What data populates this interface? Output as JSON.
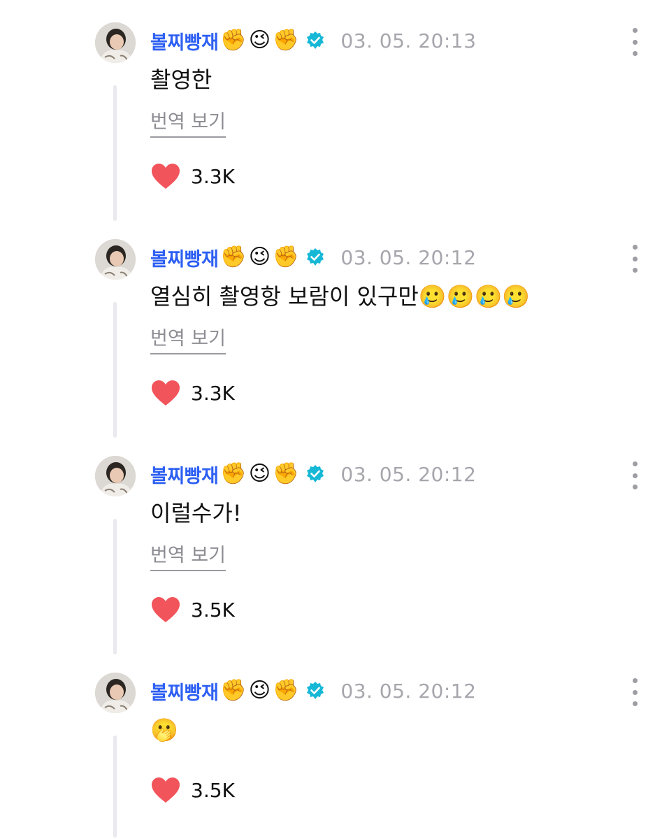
{
  "comments": [
    {
      "username": "볼찌빵재",
      "name_emojis": [
        "✊",
        "😉",
        "✊"
      ],
      "timestamp": "03. 05. 20:13",
      "text": "촬영한",
      "translate_label": "번역 보기",
      "likes": "3.3K"
    },
    {
      "username": "볼찌빵재",
      "name_emojis": [
        "✊",
        "😉",
        "✊"
      ],
      "timestamp": "03. 05. 20:12",
      "text": "열심히 촬영항 보람이 있구만🥲🥲🥲🥲",
      "translate_label": "번역 보기",
      "likes": "3.3K"
    },
    {
      "username": "볼찌빵재",
      "name_emojis": [
        "✊",
        "😉",
        "✊"
      ],
      "timestamp": "03. 05. 20:12",
      "text": "이럴수가!",
      "translate_label": "번역 보기",
      "likes": "3.5K"
    },
    {
      "username": "볼찌빵재",
      "name_emojis": [
        "✊",
        "😉",
        "✊"
      ],
      "timestamp": "03. 05. 20:12",
      "text": "🫢",
      "translate_label": "",
      "likes": "3.5K"
    }
  ],
  "colors": {
    "username": "#2d5ff3",
    "verified_badge": "#16b8d6",
    "heart": "#f2545b",
    "timestamp": "#a6a6ad"
  },
  "icons": {
    "verified": "verified-badge-icon",
    "like": "heart-icon",
    "more": "more-vertical-icon"
  }
}
